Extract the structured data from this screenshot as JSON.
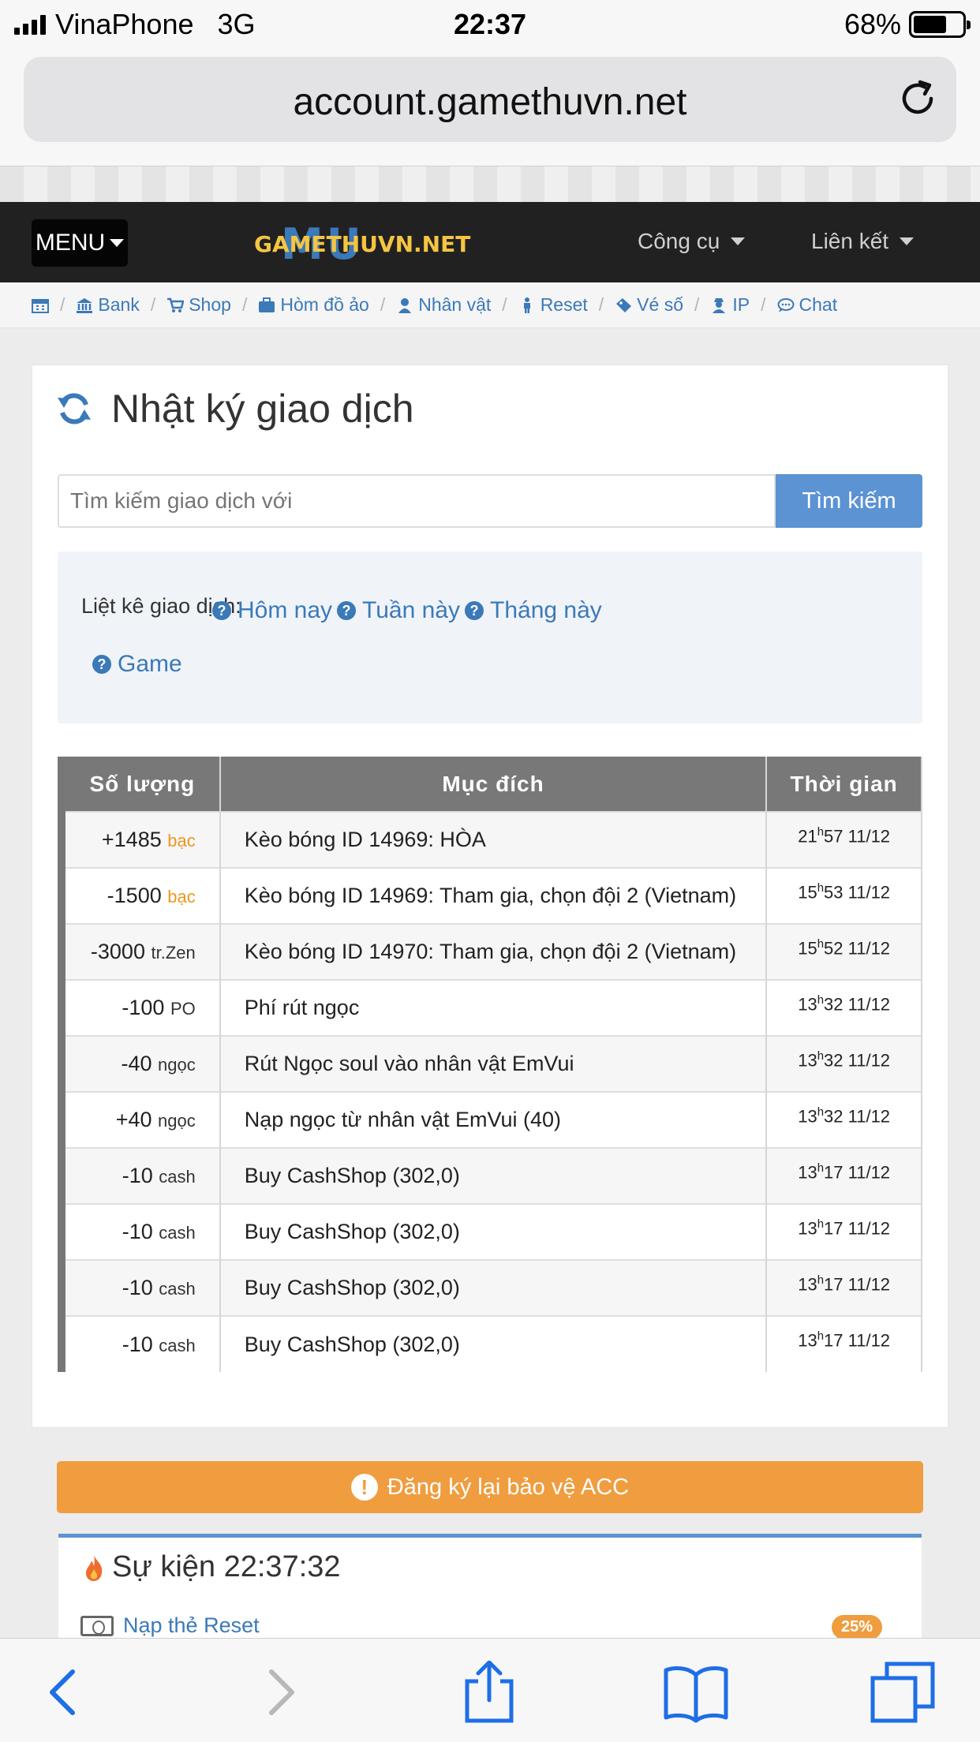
{
  "status_bar": {
    "carrier": "VinaPhone",
    "network": "3G",
    "time": "22:37",
    "battery": "68%"
  },
  "browser": {
    "url": "account.gamethuvn.net"
  },
  "navbar": {
    "menu_label": "MENU",
    "logo_text": "GAMETHUVN.NET",
    "logo_bg": "MU",
    "tools_label": "Công cụ",
    "links_label": "Liên kết"
  },
  "breadcrumbs": [
    {
      "label": "",
      "icon": "calendar-icon"
    },
    {
      "label": "Bank",
      "icon": "bank-icon"
    },
    {
      "label": "Shop",
      "icon": "cart-icon"
    },
    {
      "label": "Hòm đồ ảo",
      "icon": "briefcase-icon"
    },
    {
      "label": "Nhân vật",
      "icon": "user-icon"
    },
    {
      "label": "Reset",
      "icon": "male-icon"
    },
    {
      "label": "Vé số",
      "icon": "ticket-icon"
    },
    {
      "label": "IP",
      "icon": "user-secret-icon"
    },
    {
      "label": "Chat",
      "icon": "chat-icon"
    }
  ],
  "page": {
    "title": "Nhật ký giao dịch"
  },
  "search": {
    "placeholder": "Tìm kiếm giao dịch với",
    "button_label": "Tìm kiếm"
  },
  "filter": {
    "label": "Liệt kê giao dịch:",
    "options": [
      "Hôm nay",
      "Tuần này",
      "Tháng này",
      "Game"
    ]
  },
  "table": {
    "headers": [
      "Số lượng",
      "Mục đích",
      "Thời gian"
    ],
    "rows": [
      {
        "amount": "+1485",
        "unit": "bạc",
        "purpose": "Kèo bóng ID 14969: HÒA",
        "hour": "21",
        "time_rest": "57 11/12"
      },
      {
        "amount": "-1500",
        "unit": "bạc",
        "purpose": "Kèo bóng ID 14969: Tham gia, chọn đội 2 (Vietnam)",
        "hour": "15",
        "time_rest": "53 11/12"
      },
      {
        "amount": "-3000",
        "unit": "tr.Zen",
        "purpose": "Kèo bóng ID 14970: Tham gia, chọn đội 2 (Vietnam)",
        "hour": "15",
        "time_rest": "52 11/12"
      },
      {
        "amount": "-100",
        "unit": "PO",
        "purpose": "Phí rút ngọc",
        "hour": "13",
        "time_rest": "32 11/12"
      },
      {
        "amount": "-40",
        "unit": "ngọc",
        "purpose": "Rút Ngọc soul vào nhân vật EmVui",
        "hour": "13",
        "time_rest": "32 11/12"
      },
      {
        "amount": "+40",
        "unit": "ngọc",
        "purpose": "Nạp ngọc từ nhân vật EmVui (40)",
        "hour": "13",
        "time_rest": "32 11/12"
      },
      {
        "amount": "-10",
        "unit": "cash",
        "purpose": "Buy CashShop (302,0)",
        "hour": "13",
        "time_rest": "17 11/12"
      },
      {
        "amount": "-10",
        "unit": "cash",
        "purpose": "Buy CashShop (302,0)",
        "hour": "13",
        "time_rest": "17 11/12"
      },
      {
        "amount": "-10",
        "unit": "cash",
        "purpose": "Buy CashShop (302,0)",
        "hour": "13",
        "time_rest": "17 11/12"
      },
      {
        "amount": "-10",
        "unit": "cash",
        "purpose": "Buy CashShop (302,0)",
        "hour": "13",
        "time_rest": "17 11/12"
      }
    ],
    "hour_marker": "h"
  },
  "alert": {
    "label": "Đăng ký lại bảo vệ ACC"
  },
  "event": {
    "title": "Sự kiện 22:37:32",
    "item_label": "Nạp thẻ Reset",
    "item_percent": "25%"
  },
  "colors": {
    "link": "#3b79b8",
    "accent_orange": "#ef9d3f",
    "search_button": "#5b93d3",
    "navbar": "#212121",
    "table_header": "#787878"
  }
}
